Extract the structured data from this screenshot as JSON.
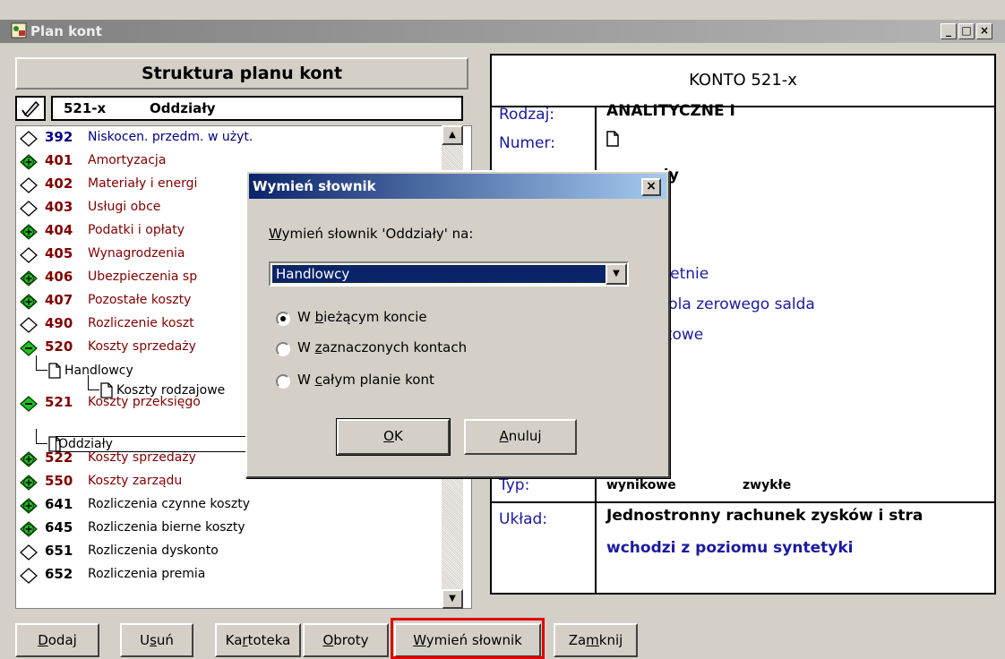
{
  "window": {
    "title": "Plan kont"
  },
  "left": {
    "header": "Struktura planu kont",
    "selected": {
      "code": "521-x",
      "name": "Oddziały"
    },
    "tree": [
      {
        "code": "392",
        "name": "Niskocen. przedm. w użyt.",
        "icon": "diamond-empty-icon",
        "color": "navy"
      },
      {
        "code": "401",
        "name": "Amortyzacja",
        "icon": "plus-circle-icon",
        "color": "maroon"
      },
      {
        "code": "402",
        "name": "Materiały i energi",
        "icon": "diamond-empty-icon",
        "color": "maroon"
      },
      {
        "code": "403",
        "name": "Usługi obce",
        "icon": "diamond-empty-icon",
        "color": "maroon"
      },
      {
        "code": "404",
        "name": "Podatki i opłaty",
        "icon": "plus-circle-icon",
        "color": "maroon"
      },
      {
        "code": "405",
        "name": "Wynagrodzenia",
        "icon": "diamond-empty-icon",
        "color": "maroon"
      },
      {
        "code": "406",
        "name": "Ubezpieczenia sp",
        "icon": "plus-circle-icon",
        "color": "maroon"
      },
      {
        "code": "407",
        "name": "Pozostałe koszty",
        "icon": "plus-circle-icon",
        "color": "maroon"
      },
      {
        "code": "490",
        "name": "Rozliczenie koszt",
        "icon": "diamond-empty-icon",
        "color": "maroon"
      },
      {
        "code": "520",
        "name": "Koszty sprzedaży",
        "icon": "minus-diamond-icon",
        "color": "maroon"
      },
      {
        "code": "521",
        "name": "Koszty przeksięgo",
        "icon": "minus-diamond-icon",
        "color": "maroon"
      },
      {
        "code": "522",
        "name": "Koszty sprzedaży",
        "icon": "plus-circle-icon",
        "color": "maroon"
      },
      {
        "code": "550",
        "name": "Koszty zarządu",
        "icon": "plus-circle-icon",
        "color": "maroon"
      },
      {
        "code": "641",
        "name": "Rozliczenia czynne koszty",
        "icon": "plus-circle-icon",
        "color": "blk"
      },
      {
        "code": "645",
        "name": "Rozliczenia bierne koszty",
        "icon": "plus-circle-icon",
        "color": "blk"
      },
      {
        "code": "651",
        "name": "Rozliczenia dyskonto",
        "icon": "diamond-empty-icon",
        "color": "blk"
      },
      {
        "code": "652",
        "name": "Rozliczenia premia",
        "icon": "diamond-empty-icon",
        "color": "blk"
      }
    ],
    "children": {
      "handlowcy": "Handlowcy",
      "koszty_rodzajowe": "Koszty rodzajowe",
      "oddzialy": "Oddziały"
    }
  },
  "right": {
    "header": "KONTO  521-x",
    "rodzaj_label": "Rodzaj:",
    "rodzaj_value": "ANALITYCZNE    I",
    "numer_label": "Numer:",
    "skrot_value_partial": "ały",
    "opt1_partial": "oletnie",
    "opt2_partial": "trola zerowego salda",
    "opt3_partial": "utowe",
    "typ_label": "Typ:",
    "typ_value1": "wynikowe",
    "typ_value2": "zwykłe",
    "uklad_label": "Układ:",
    "uklad_value": "Jednostronny rachunek zysków i stra",
    "uklad_note": "wchodzi z poziomu syntetyki"
  },
  "dialog": {
    "title": "Wymień słownik",
    "label_prefix": "W",
    "label_rest": "ymień słownik 'Oddziały' na:",
    "combo_value": "Handlowcy",
    "radio1_a": "W ",
    "radio1_u": "b",
    "radio1_b": "ieżącym koncie",
    "radio2_a": "W ",
    "radio2_u": "z",
    "radio2_b": "aznaczonych kontach",
    "radio3_a": "W ",
    "radio3_u": "c",
    "radio3_b": "ałym planie kont",
    "ok_u": "O",
    "ok_rest": "K",
    "cancel_u": "A",
    "cancel_rest": "nuluj"
  },
  "buttons": {
    "dodaj_u": "D",
    "dodaj_rest": "odaj",
    "usun_a": "U",
    "usun_u": "s",
    "usun_b": "uń",
    "kartoteka_a": "Ka",
    "kartoteka_u": "r",
    "kartoteka_b": "toteka",
    "obroty_u": "O",
    "obroty_rest": "broty",
    "wymien_u": "W",
    "wymien_rest": "ymień słownik",
    "zamknij_a": "Za",
    "zamknij_u": "m",
    "zamknij_b": "knij"
  },
  "colors": {
    "title_active": "#0a246a",
    "title_inactive": "#808080",
    "maroon": "#800000",
    "highlight": "#e00000"
  }
}
